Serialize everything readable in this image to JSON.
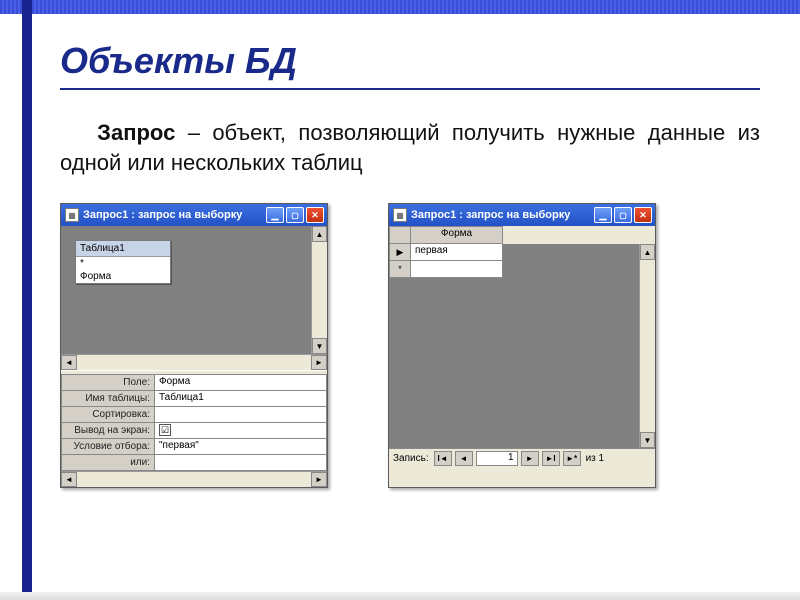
{
  "title": "Объекты БД",
  "para_lead": "Запрос",
  "para_rest": " – объект, позволяющий получить нужные данные из одной или нескольких таблиц",
  "win1": {
    "title": "Запрос1 : запрос на выборку",
    "table_name": "Таблица1",
    "table_rows": [
      "*",
      "Форма"
    ],
    "grid": {
      "labels": {
        "field": "Поле:",
        "table": "Имя таблицы:",
        "sort": "Сортировка:",
        "show": "Вывод на экран:",
        "criteria": "Условие отбора:",
        "or": "или:"
      },
      "field": "Форма",
      "table": "Таблица1",
      "sort": "",
      "show_checked": "☑",
      "criteria": "\"первая\"",
      "or": ""
    }
  },
  "win2": {
    "title": "Запрос1 : запрос на выборку",
    "column": "Форма",
    "rows": [
      {
        "marker": "▶",
        "value": "первая"
      },
      {
        "marker": "*",
        "value": ""
      }
    ],
    "nav": {
      "label": "Запись:",
      "current": "1",
      "total": "из 1"
    }
  }
}
